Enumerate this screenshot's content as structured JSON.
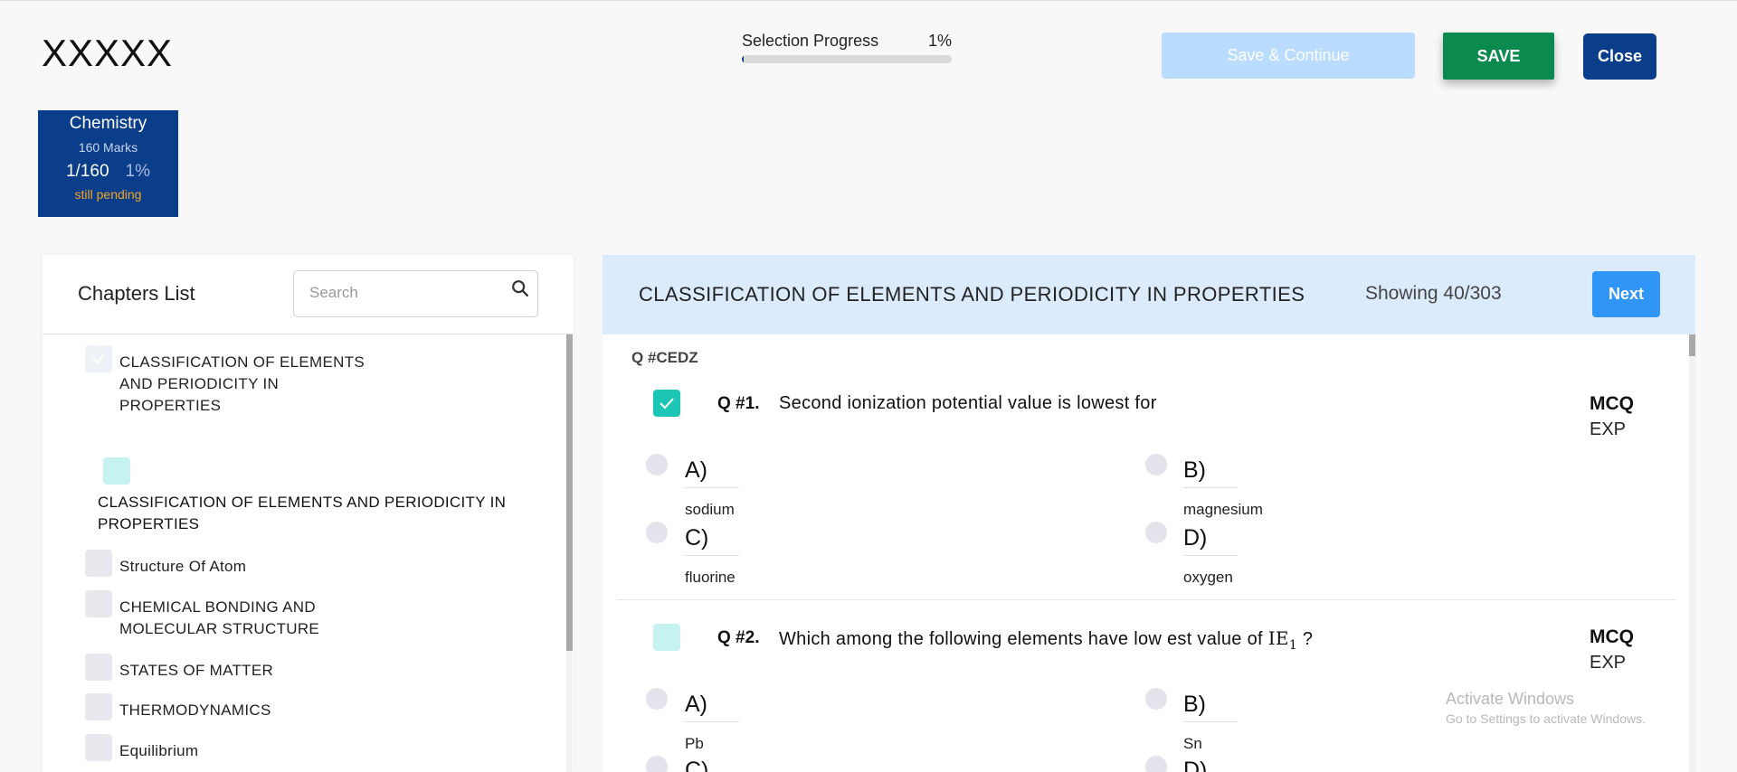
{
  "header": {
    "app_title": "XXXXX",
    "progress": {
      "label": "Selection Progress",
      "percent_text": "1%",
      "fraction": 0.01
    },
    "buttons": {
      "save_continue": "Save & Continue",
      "save": "SAVE",
      "close": "Close"
    }
  },
  "subject": {
    "name": "Chemistry",
    "marks": "160 Marks",
    "count": "1/160",
    "percent": "1%",
    "status": "still pending"
  },
  "chapters": {
    "title": "Chapters List",
    "search_placeholder": "Search",
    "items": [
      {
        "label_lines": [
          "CLASSIFICATION OF ELEMENTS",
          "AND PERIODICITY IN",
          "PROPERTIES"
        ],
        "checked": true
      },
      {
        "label_lines": [
          "CLASSIFICATION OF ELEMENTS AND PERIODICITY IN",
          "PROPERTIES"
        ],
        "checked": false,
        "sub": true
      },
      {
        "label_lines": [
          "Structure Of Atom"
        ],
        "checked": false
      },
      {
        "label_lines": [
          "CHEMICAL BONDING AND",
          "MOLECULAR STRUCTURE"
        ],
        "checked": false
      },
      {
        "label_lines": [
          "STATES OF MATTER"
        ],
        "checked": false
      },
      {
        "label_lines": [
          "THERMODYNAMICS"
        ],
        "checked": false
      },
      {
        "label_lines": [
          "Equilibrium"
        ],
        "checked": false
      }
    ]
  },
  "questions_panel": {
    "chapter_title": "CLASSIFICATION OF ELEMENTS AND PERIODICITY IN PROPERTIES",
    "showing": "Showing 40/303",
    "next_label": "Next",
    "code": "Q #CEDZ",
    "questions": [
      {
        "number": "Q #1.",
        "text": "Second ionization potential value is lowest for",
        "type": "MCQ",
        "exp": "EXP",
        "selected": true,
        "options": [
          {
            "letter": "A)",
            "value": "sodium"
          },
          {
            "letter": "B)",
            "value": "magnesium"
          },
          {
            "letter": "C)",
            "value": "fluorine"
          },
          {
            "letter": "D)",
            "value": "oxygen"
          }
        ]
      },
      {
        "number": "Q #2.",
        "text": "Which among the following elements have low est value of",
        "formula": "IE",
        "formula_sub": "1",
        "text_end": "?",
        "type": "MCQ",
        "exp": "EXP",
        "selected": false,
        "options": [
          {
            "letter": "A)",
            "value": "Pb"
          },
          {
            "letter": "B)",
            "value": "Sn"
          },
          {
            "letter": "C)",
            "value": ""
          },
          {
            "letter": "D)",
            "value": ""
          }
        ]
      }
    ]
  },
  "watermark": {
    "title": "Activate Windows",
    "subtitle": "Go to Settings to activate Windows."
  },
  "colors": {
    "primary_navy": "#0a3d8a",
    "save_green": "#0a8a4f",
    "next_blue": "#2f95f7",
    "checked_teal": "#1cc6b7",
    "pending_orange": "#f5a623"
  }
}
